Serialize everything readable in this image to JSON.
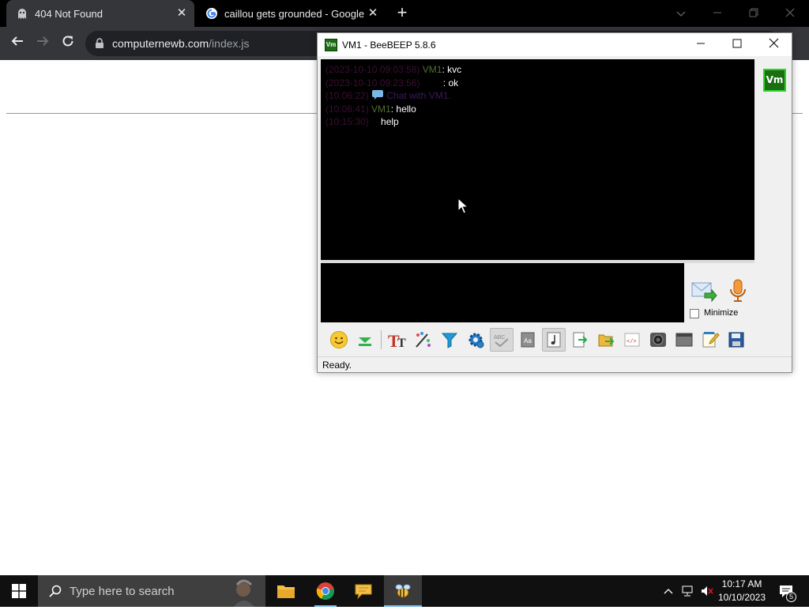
{
  "browser": {
    "tabs": [
      {
        "title": "404 Not Found",
        "favicon": "ghost-icon",
        "active": true
      },
      {
        "title": "caillou gets grounded - Google S",
        "favicon": "google-icon",
        "active": false
      }
    ],
    "url_host": "computernewb.com",
    "url_path": "/index.js",
    "close_glyph": "✕",
    "newtab_glyph": "+"
  },
  "beebeep": {
    "title": "VM1 - BeeBEEP 5.8.6",
    "messages": [
      {
        "timestamp": "(2023-10-10 09:03:58)",
        "user": "VM1",
        "separator": ": ",
        "text": "kvc"
      },
      {
        "timestamp": "(2023-10-10 09:23:56)",
        "user": "",
        "separator": ": ",
        "text": "ok"
      },
      {
        "timestamp": "(10:06:22)",
        "system": "Chat with VM1."
      },
      {
        "timestamp": "(10:06:41)",
        "user": "VM1",
        "separator": ": ",
        "text": "hello"
      },
      {
        "timestamp": "(10:15:30)",
        "user": "",
        "separator": "",
        "text": "help"
      }
    ],
    "minimize_label": "Minimize",
    "status": "Ready.",
    "avatar_text": "Vm",
    "appicon_text": "Vm",
    "toolbar_icons": [
      "emoticon-icon",
      "collapse-icon",
      "font-icon",
      "color-palette-icon",
      "filter-icon",
      "settings-gear-icon",
      "spellcheck-icon",
      "dictionary-icon",
      "music-note-icon",
      "export-icon",
      "send-file-icon",
      "html-code-icon",
      "screenshot-icon",
      "chat-window-icon",
      "edit-note-icon",
      "save-icon"
    ]
  },
  "taskbar": {
    "search_placeholder": "Type here to search",
    "time": "10:17 AM",
    "date": "10/10/2023",
    "notification_count": "5"
  }
}
